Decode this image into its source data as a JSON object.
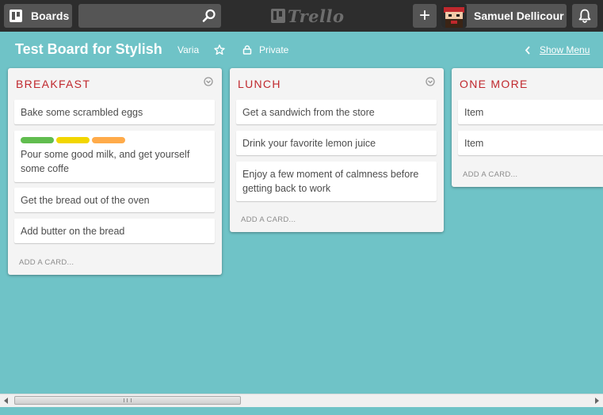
{
  "header": {
    "boards_label": "Boards",
    "search": {
      "value": "",
      "placeholder": ""
    },
    "logo_text": "Trello",
    "add_label": "+",
    "member_name": "Samuel Dellicour",
    "icons": {
      "boards": "boards-icon",
      "search": "search-icon",
      "notifications": "bell-icon",
      "add": "plus-icon"
    }
  },
  "board": {
    "title": "Test Board for Stylish",
    "organization": "Varia",
    "visibility": "Private",
    "show_menu": "Show Menu",
    "colors": {
      "background": "#6fc3c7",
      "header": "#2d2d2d",
      "list_title": "#c0282d"
    }
  },
  "lists": [
    {
      "title": "BREAKFAST",
      "cards": [
        {
          "text": "Bake some scrambled eggs"
        },
        {
          "text": "Pour some good milk, and get yourself some coffe",
          "labels": [
            "#61bd4f",
            "#f2d600",
            "#ffab4a"
          ]
        },
        {
          "text": "Get the bread out of the oven"
        },
        {
          "text": "Add butter on the bread"
        }
      ],
      "add_card": "ADD A CARD..."
    },
    {
      "title": "LUNCH",
      "cards": [
        {
          "text": "Get a sandwich from the store"
        },
        {
          "text": "Drink your favorite lemon juice"
        },
        {
          "text": "Enjoy a few moment of calmness before getting back to work"
        }
      ],
      "add_card": "ADD A CARD..."
    },
    {
      "title": "ONE MORE",
      "cards": [
        {
          "text": "Item"
        },
        {
          "text": "Item"
        }
      ],
      "add_card": "ADD A CARD..."
    }
  ]
}
